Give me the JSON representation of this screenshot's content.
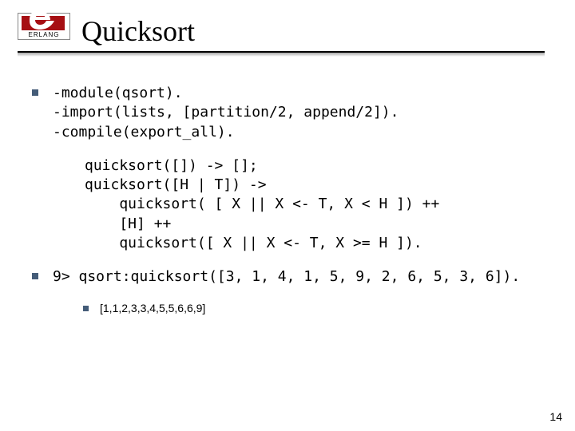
{
  "logo": {
    "text": "ERLANG"
  },
  "title": "Quicksort",
  "blocks": {
    "b1": {
      "l1": "-module(qsort).",
      "l2": "-import(lists, [partition/2, append/2]).",
      "l3": "-compile(export_all)."
    },
    "b2": {
      "l1": "quicksort([]) -> [];",
      "l2": "quicksort([H | T]) ->",
      "l3": "    quicksort( [ X || X <- T, X < H ]) ++",
      "l4": "    [H] ++",
      "l5": "    quicksort([ X || X <- T, X >= H ])."
    },
    "b3": {
      "l1": "9> qsort:quicksort([3, 1, 4, 1, 5, 9, 2, 6, 5, 3, 6])."
    },
    "result": "[1,1,2,3,3,4,5,5,6,6,9]"
  },
  "pageNumber": "14"
}
